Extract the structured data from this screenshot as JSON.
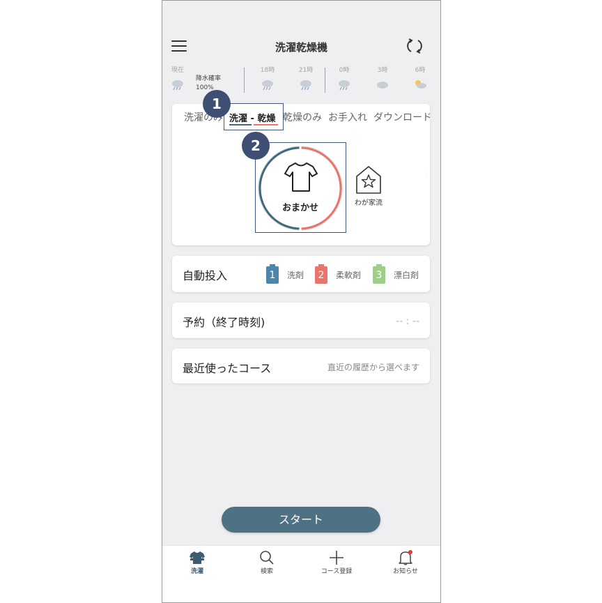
{
  "header": {
    "title": "洗濯乾燥機",
    "menu_icon": "hamburger-menu-icon",
    "refresh_icon": "refresh-icon"
  },
  "weather": {
    "now_label": "現在",
    "rain_prob_label": "降水確率",
    "rain_prob_value": "100%",
    "forecast": [
      {
        "time": "18時",
        "icon": "rain-cloud-icon"
      },
      {
        "time": "21時",
        "icon": "rain-cloud-icon"
      },
      {
        "time": "0時",
        "icon": "rain-cloud-icon"
      },
      {
        "time": "3時",
        "icon": "cloud-icon"
      },
      {
        "time": "6時",
        "icon": "sun-cloud-icon"
      }
    ]
  },
  "mode_tabs": [
    {
      "label": "洗濯のみ"
    },
    {
      "label": "洗濯 - 乾燥",
      "active": true
    },
    {
      "label": "乾燥のみ"
    },
    {
      "label": "お手入れ"
    },
    {
      "label": "ダウンロード"
    }
  ],
  "annotations": {
    "badge1": "1",
    "badge2": "2"
  },
  "courses": {
    "selected": {
      "label": "おまかせ",
      "icon": "shirt-icon"
    },
    "next": {
      "label": "わが家流",
      "icon": "house-star-icon"
    },
    "partial_label": "…"
  },
  "auto_dose": {
    "label": "自動投入",
    "items": [
      {
        "num": "1",
        "label": "洗剤",
        "color": "#4f85a8"
      },
      {
        "num": "2",
        "label": "柔軟剤",
        "color": "#e8756a"
      },
      {
        "num": "3",
        "label": "漂白剤",
        "color": "#9fcf86"
      }
    ]
  },
  "reservation": {
    "label": "予約（終了時刻)",
    "value": "-- : --"
  },
  "recent": {
    "label": "最近使ったコース",
    "hint": "直近の履歴から選べます"
  },
  "start_button": {
    "label": "スタート"
  },
  "bottom_nav": [
    {
      "label": "洗濯",
      "icon": "laundry-shirt-icon",
      "active": true
    },
    {
      "label": "検索",
      "icon": "search-icon"
    },
    {
      "label": "コース登録",
      "icon": "plus-icon"
    },
    {
      "label": "お知らせ",
      "icon": "bell-icon",
      "has_badge": true
    }
  ],
  "colors": {
    "accent_teal": "#3f6a7e",
    "accent_red": "#e8756a",
    "start_button": "#4e7283",
    "annotation": "#3f4f74"
  }
}
